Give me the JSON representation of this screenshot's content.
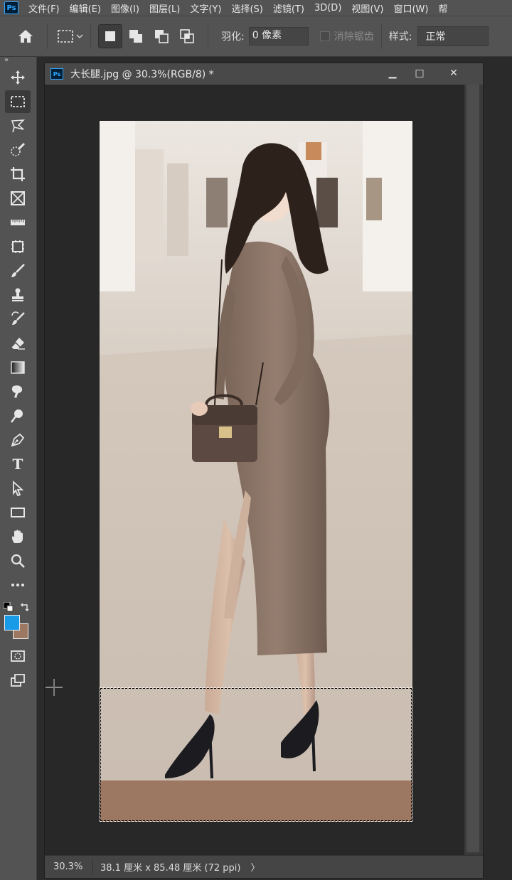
{
  "app": {
    "logo": "Ps"
  },
  "menu": [
    "文件(F)",
    "编辑(E)",
    "图像(I)",
    "图层(L)",
    "文字(Y)",
    "选择(S)",
    "滤镜(T)",
    "3D(D)",
    "视图(V)",
    "窗口(W)",
    "帮"
  ],
  "options": {
    "feather_label": "羽化:",
    "feather_value": "0 像素",
    "antialias_label": "消除锯齿",
    "style_label": "样式:",
    "style_value": "正常"
  },
  "document": {
    "title": "大长腿.jpg @ 30.3%(RGB/8) *",
    "zoom": "30.3%",
    "info": "38.1 厘米 x 85.48 厘米 (72 ppi)",
    "info_arrow": "〉"
  },
  "colors": {
    "foreground": "#1a9be8",
    "background": "#9c7862",
    "ui_panel": "#535353",
    "canvas_bg": "#282828"
  },
  "tools": [
    "move-tool",
    "rect-marquee-tool",
    "lasso-tool",
    "quick-select-tool",
    "crop-tool",
    "frame-tool",
    "ruler-tool",
    "patch-tool",
    "brush-tool",
    "stamp-tool",
    "history-brush-tool",
    "eraser-tool",
    "gradient-tool",
    "smudge-tool",
    "dodge-tool",
    "pen-tool",
    "type-tool",
    "path-select-tool",
    "rectangle-tool",
    "hand-tool",
    "zoom-tool",
    "more-tools"
  ],
  "type_tool_glyph": "T",
  "toolbar_collapse": "»",
  "window_controls": {
    "minimize": "▁",
    "maximize": "□",
    "close": "✕"
  }
}
